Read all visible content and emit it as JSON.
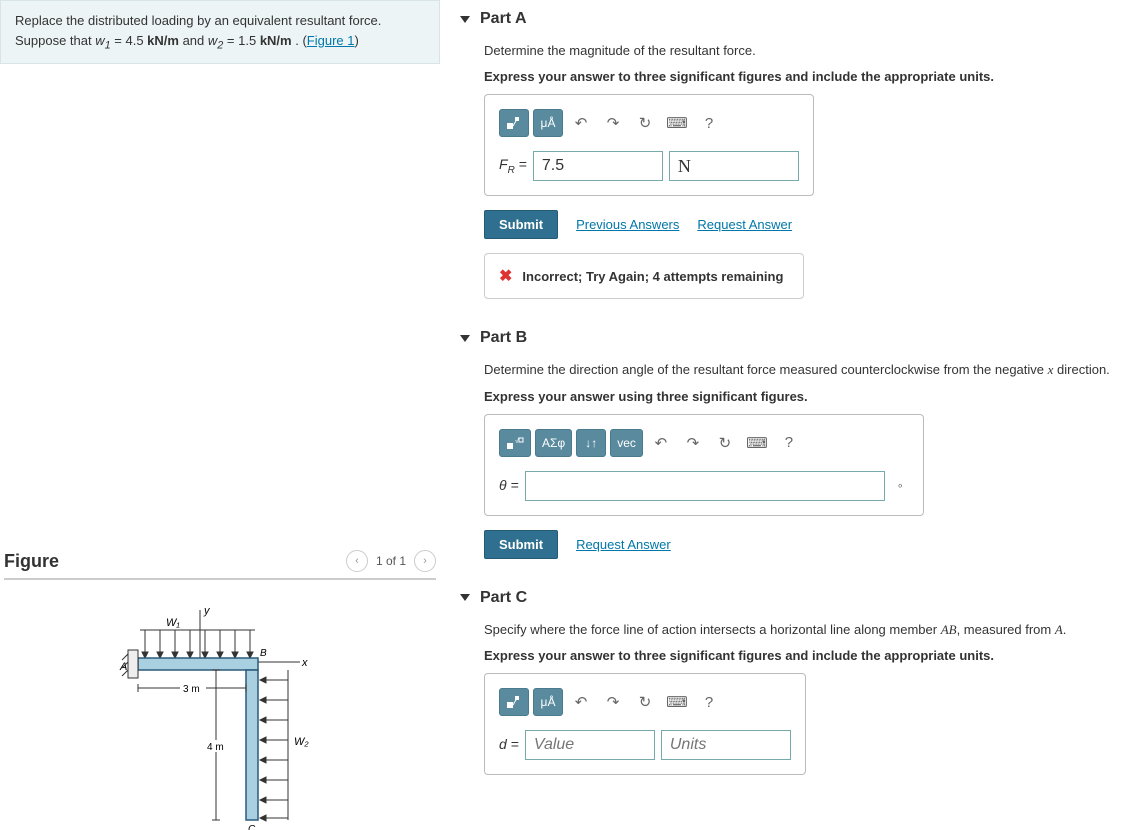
{
  "problem": {
    "intro": "Replace the distributed loading by an equivalent resultant force. Suppose that",
    "w1_var": "w",
    "w1_sub": "1",
    "w1_eq": " = 4.5 ",
    "w1_unit": "kN/m",
    "and": " and ",
    "w2_var": "w",
    "w2_sub": "2",
    "w2_eq": " = 1.5 ",
    "w2_unit": "kN/m",
    "tail": " . (",
    "figlink": "Figure 1",
    "close": ")"
  },
  "figure": {
    "title": "Figure",
    "count": "1 of 1",
    "labels": {
      "w1": "W₁",
      "w2": "W₂",
      "A": "A",
      "B": "B",
      "C": "C",
      "x": "x",
      "y": "y",
      "len1": "3 m",
      "len2": "4 m"
    }
  },
  "partA": {
    "title": "Part A",
    "prompt": "Determine the magnitude of the resultant force.",
    "instr": "Express your answer to three significant figures and include the appropriate units.",
    "tool_mu": "μÅ",
    "var": "F",
    "sub": "R",
    "eq": " = ",
    "value": "7.5",
    "units": "N",
    "submit": "Submit",
    "prev": "Previous Answers",
    "req": "Request Answer",
    "feedback": "Incorrect; Try Again; 4 attempts remaining"
  },
  "partB": {
    "title": "Part B",
    "prompt_pre": "Determine the direction angle of the resultant force measured counterclockwise from the negative ",
    "prompt_var": "x",
    "prompt_post": " direction.",
    "instr": "Express your answer using three significant figures.",
    "tool_sigma": "ΑΣφ",
    "tool_vec": "vec",
    "var": "θ",
    "eq": " = ",
    "suffix": "∘",
    "submit": "Submit",
    "req": "Request Answer"
  },
  "partC": {
    "title": "Part C",
    "prompt_pre": "Specify where the force line of action intersects a horizontal line along member ",
    "prompt_var1": "AB",
    "prompt_mid": ", measured from ",
    "prompt_var2": "A",
    "prompt_post": ".",
    "instr": "Express your answer to three significant figures and include the appropriate units.",
    "tool_mu": "μÅ",
    "var": "d",
    "eq": " = ",
    "value_ph": "Value",
    "units_ph": "Units"
  }
}
